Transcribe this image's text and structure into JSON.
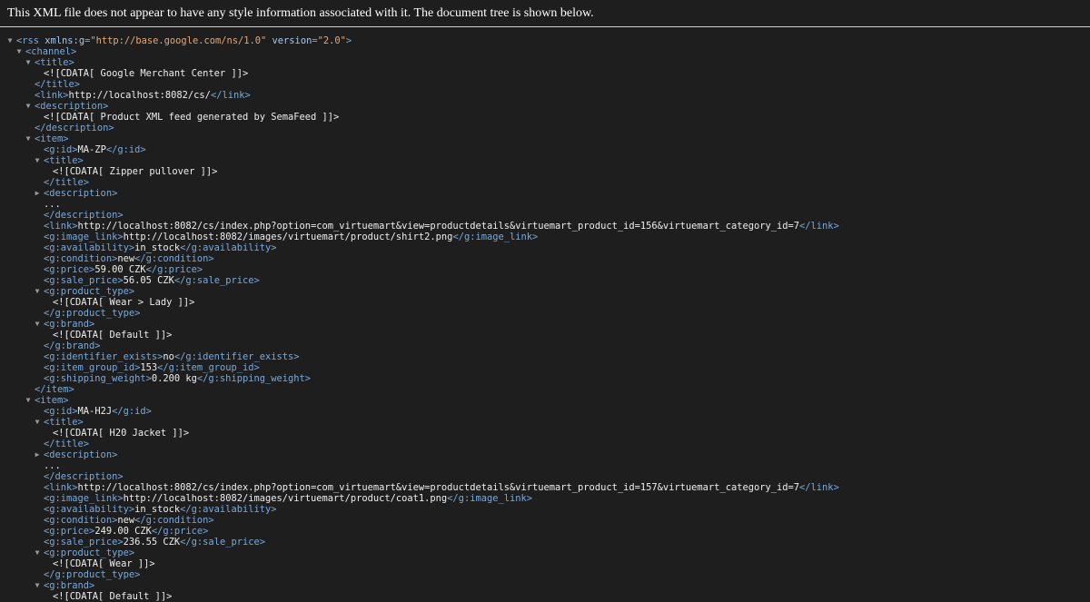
{
  "notice": "This XML file does not appear to have any style information associated with it. The document tree is shown below.",
  "icons": {
    "expanded": "▼",
    "collapsed": "▶"
  },
  "lines": [
    {
      "indent": 0,
      "toggle": "expanded",
      "tokens": [
        {
          "c": "tag",
          "t": "<rss "
        },
        {
          "c": "attr",
          "t": "xmlns:g"
        },
        {
          "c": "tag",
          "t": "="
        },
        {
          "c": "aval",
          "t": "\"http://base.google.com/ns/1.0\""
        },
        {
          "c": "attr",
          "t": " version"
        },
        {
          "c": "tag",
          "t": "="
        },
        {
          "c": "aval",
          "t": "\"2.0\""
        },
        {
          "c": "tag",
          "t": ">"
        }
      ]
    },
    {
      "indent": 1,
      "toggle": "expanded",
      "tokens": [
        {
          "c": "tag",
          "t": "<channel>"
        }
      ]
    },
    {
      "indent": 2,
      "toggle": "expanded",
      "tokens": [
        {
          "c": "tag",
          "t": "<title>"
        }
      ]
    },
    {
      "indent": 3,
      "toggle": null,
      "tokens": [
        {
          "c": "txt",
          "t": "<![CDATA[ Google Merchant Center ]]>"
        }
      ]
    },
    {
      "indent": 2,
      "toggle": null,
      "tokens": [
        {
          "c": "tag",
          "t": "</title>"
        }
      ]
    },
    {
      "indent": 2,
      "toggle": null,
      "tokens": [
        {
          "c": "tag",
          "t": "<link>"
        },
        {
          "c": "txt",
          "t": "http://localhost:8082/cs/"
        },
        {
          "c": "tag",
          "t": "</link>"
        }
      ]
    },
    {
      "indent": 2,
      "toggle": "expanded",
      "tokens": [
        {
          "c": "tag",
          "t": "<description>"
        }
      ]
    },
    {
      "indent": 3,
      "toggle": null,
      "tokens": [
        {
          "c": "txt",
          "t": "<![CDATA[ Product XML feed generated by SemaFeed ]]>"
        }
      ]
    },
    {
      "indent": 2,
      "toggle": null,
      "tokens": [
        {
          "c": "tag",
          "t": "</description>"
        }
      ]
    },
    {
      "indent": 2,
      "toggle": "expanded",
      "tokens": [
        {
          "c": "tag",
          "t": "<item>"
        }
      ]
    },
    {
      "indent": 3,
      "toggle": null,
      "tokens": [
        {
          "c": "tag",
          "t": "<g:id>"
        },
        {
          "c": "txt",
          "t": "MA-ZP"
        },
        {
          "c": "tag",
          "t": "</g:id>"
        }
      ]
    },
    {
      "indent": 3,
      "toggle": "expanded",
      "tokens": [
        {
          "c": "tag",
          "t": "<title>"
        }
      ]
    },
    {
      "indent": 4,
      "toggle": null,
      "tokens": [
        {
          "c": "txt",
          "t": "<![CDATA[ Zipper pullover ]]>"
        }
      ]
    },
    {
      "indent": 3,
      "toggle": null,
      "tokens": [
        {
          "c": "tag",
          "t": "</title>"
        }
      ]
    },
    {
      "indent": 3,
      "toggle": "collapsed",
      "tokens": [
        {
          "c": "tag",
          "t": "<description>"
        }
      ]
    },
    {
      "indent": 3,
      "toggle": null,
      "tokens": [
        {
          "c": "txt",
          "t": "..."
        }
      ]
    },
    {
      "indent": 3,
      "toggle": null,
      "tokens": [
        {
          "c": "tag",
          "t": "</description>"
        }
      ]
    },
    {
      "indent": 3,
      "toggle": null,
      "tokens": [
        {
          "c": "tag",
          "t": "<link>"
        },
        {
          "c": "txt",
          "t": "http://localhost:8082/cs/index.php?option=com_virtuemart&view=productdetails&virtuemart_product_id=156&virtuemart_category_id=7"
        },
        {
          "c": "tag",
          "t": "</link>"
        }
      ]
    },
    {
      "indent": 3,
      "toggle": null,
      "tokens": [
        {
          "c": "tag",
          "t": "<g:image_link>"
        },
        {
          "c": "txt",
          "t": "http://localhost:8082/images/virtuemart/product/shirt2.png"
        },
        {
          "c": "tag",
          "t": "</g:image_link>"
        }
      ]
    },
    {
      "indent": 3,
      "toggle": null,
      "tokens": [
        {
          "c": "tag",
          "t": "<g:availability>"
        },
        {
          "c": "txt",
          "t": "in_stock"
        },
        {
          "c": "tag",
          "t": "</g:availability>"
        }
      ]
    },
    {
      "indent": 3,
      "toggle": null,
      "tokens": [
        {
          "c": "tag",
          "t": "<g:condition>"
        },
        {
          "c": "txt",
          "t": "new"
        },
        {
          "c": "tag",
          "t": "</g:condition>"
        }
      ]
    },
    {
      "indent": 3,
      "toggle": null,
      "tokens": [
        {
          "c": "tag",
          "t": "<g:price>"
        },
        {
          "c": "txt",
          "t": "59.00 CZK"
        },
        {
          "c": "tag",
          "t": "</g:price>"
        }
      ]
    },
    {
      "indent": 3,
      "toggle": null,
      "tokens": [
        {
          "c": "tag",
          "t": "<g:sale_price>"
        },
        {
          "c": "txt",
          "t": "56.05 CZK"
        },
        {
          "c": "tag",
          "t": "</g:sale_price>"
        }
      ]
    },
    {
      "indent": 3,
      "toggle": "expanded",
      "tokens": [
        {
          "c": "tag",
          "t": "<g:product_type>"
        }
      ]
    },
    {
      "indent": 4,
      "toggle": null,
      "tokens": [
        {
          "c": "txt",
          "t": "<![CDATA[ Wear > Lady ]]>"
        }
      ]
    },
    {
      "indent": 3,
      "toggle": null,
      "tokens": [
        {
          "c": "tag",
          "t": "</g:product_type>"
        }
      ]
    },
    {
      "indent": 3,
      "toggle": "expanded",
      "tokens": [
        {
          "c": "tag",
          "t": "<g:brand>"
        }
      ]
    },
    {
      "indent": 4,
      "toggle": null,
      "tokens": [
        {
          "c": "txt",
          "t": "<![CDATA[ Default ]]>"
        }
      ]
    },
    {
      "indent": 3,
      "toggle": null,
      "tokens": [
        {
          "c": "tag",
          "t": "</g:brand>"
        }
      ]
    },
    {
      "indent": 3,
      "toggle": null,
      "tokens": [
        {
          "c": "tag",
          "t": "<g:identifier_exists>"
        },
        {
          "c": "txt",
          "t": "no"
        },
        {
          "c": "tag",
          "t": "</g:identifier_exists>"
        }
      ]
    },
    {
      "indent": 3,
      "toggle": null,
      "tokens": [
        {
          "c": "tag",
          "t": "<g:item_group_id>"
        },
        {
          "c": "txt",
          "t": "153"
        },
        {
          "c": "tag",
          "t": "</g:item_group_id>"
        }
      ]
    },
    {
      "indent": 3,
      "toggle": null,
      "tokens": [
        {
          "c": "tag",
          "t": "<g:shipping_weight>"
        },
        {
          "c": "txt",
          "t": "0.200 kg"
        },
        {
          "c": "tag",
          "t": "</g:shipping_weight>"
        }
      ]
    },
    {
      "indent": 2,
      "toggle": null,
      "tokens": [
        {
          "c": "tag",
          "t": "</item>"
        }
      ]
    },
    {
      "indent": 2,
      "toggle": "expanded",
      "tokens": [
        {
          "c": "tag",
          "t": "<item>"
        }
      ]
    },
    {
      "indent": 3,
      "toggle": null,
      "tokens": [
        {
          "c": "tag",
          "t": "<g:id>"
        },
        {
          "c": "txt",
          "t": "MA-H2J"
        },
        {
          "c": "tag",
          "t": "</g:id>"
        }
      ]
    },
    {
      "indent": 3,
      "toggle": "expanded",
      "tokens": [
        {
          "c": "tag",
          "t": "<title>"
        }
      ]
    },
    {
      "indent": 4,
      "toggle": null,
      "tokens": [
        {
          "c": "txt",
          "t": "<![CDATA[ H20 Jacket ]]>"
        }
      ]
    },
    {
      "indent": 3,
      "toggle": null,
      "tokens": [
        {
          "c": "tag",
          "t": "</title>"
        }
      ]
    },
    {
      "indent": 3,
      "toggle": "collapsed",
      "tokens": [
        {
          "c": "tag",
          "t": "<description>"
        }
      ]
    },
    {
      "indent": 3,
      "toggle": null,
      "tokens": [
        {
          "c": "txt",
          "t": "..."
        }
      ]
    },
    {
      "indent": 3,
      "toggle": null,
      "tokens": [
        {
          "c": "tag",
          "t": "</description>"
        }
      ]
    },
    {
      "indent": 3,
      "toggle": null,
      "tokens": [
        {
          "c": "tag",
          "t": "<link>"
        },
        {
          "c": "txt",
          "t": "http://localhost:8082/cs/index.php?option=com_virtuemart&view=productdetails&virtuemart_product_id=157&virtuemart_category_id=7"
        },
        {
          "c": "tag",
          "t": "</link>"
        }
      ]
    },
    {
      "indent": 3,
      "toggle": null,
      "tokens": [
        {
          "c": "tag",
          "t": "<g:image_link>"
        },
        {
          "c": "txt",
          "t": "http://localhost:8082/images/virtuemart/product/coat1.png"
        },
        {
          "c": "tag",
          "t": "</g:image_link>"
        }
      ]
    },
    {
      "indent": 3,
      "toggle": null,
      "tokens": [
        {
          "c": "tag",
          "t": "<g:availability>"
        },
        {
          "c": "txt",
          "t": "in_stock"
        },
        {
          "c": "tag",
          "t": "</g:availability>"
        }
      ]
    },
    {
      "indent": 3,
      "toggle": null,
      "tokens": [
        {
          "c": "tag",
          "t": "<g:condition>"
        },
        {
          "c": "txt",
          "t": "new"
        },
        {
          "c": "tag",
          "t": "</g:condition>"
        }
      ]
    },
    {
      "indent": 3,
      "toggle": null,
      "tokens": [
        {
          "c": "tag",
          "t": "<g:price>"
        },
        {
          "c": "txt",
          "t": "249.00 CZK"
        },
        {
          "c": "tag",
          "t": "</g:price>"
        }
      ]
    },
    {
      "indent": 3,
      "toggle": null,
      "tokens": [
        {
          "c": "tag",
          "t": "<g:sale_price>"
        },
        {
          "c": "txt",
          "t": "236.55 CZK"
        },
        {
          "c": "tag",
          "t": "</g:sale_price>"
        }
      ]
    },
    {
      "indent": 3,
      "toggle": "expanded",
      "tokens": [
        {
          "c": "tag",
          "t": "<g:product_type>"
        }
      ]
    },
    {
      "indent": 4,
      "toggle": null,
      "tokens": [
        {
          "c": "txt",
          "t": "<![CDATA[ Wear ]]>"
        }
      ]
    },
    {
      "indent": 3,
      "toggle": null,
      "tokens": [
        {
          "c": "tag",
          "t": "</g:product_type>"
        }
      ]
    },
    {
      "indent": 3,
      "toggle": "expanded",
      "tokens": [
        {
          "c": "tag",
          "t": "<g:brand>"
        }
      ]
    },
    {
      "indent": 4,
      "toggle": null,
      "tokens": [
        {
          "c": "txt",
          "t": "<![CDATA[ Default ]]>"
        }
      ]
    }
  ]
}
